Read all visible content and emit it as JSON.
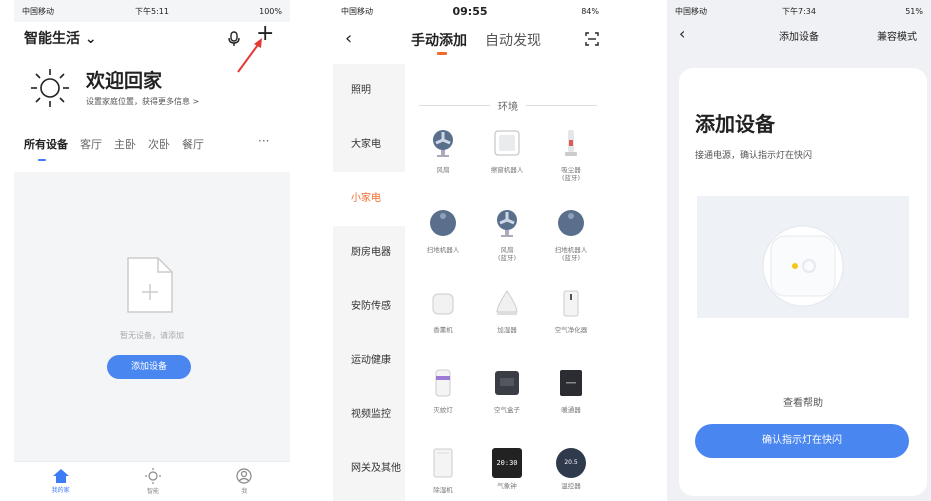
{
  "phone1": {
    "status": {
      "carrier": "中国移动",
      "time": "下午5:11",
      "battery": "100%"
    },
    "title": "智能生活",
    "title_chevron": "⌄",
    "add_icon": "+",
    "welcome": "欢迎回家",
    "welcome_sub": "设置家庭位置，获得更多信息 >",
    "tabs": [
      "所有设备",
      "客厅",
      "主卧",
      "次卧",
      "餐厅"
    ],
    "more_label": "···",
    "empty_text": "暂无设备，请添加",
    "add_button_label": "添加设备",
    "nav": [
      "我的家",
      "智能",
      "我"
    ],
    "accent": "#3d7cf5"
  },
  "phone2": {
    "status": {
      "carrier": "中国移动",
      "time": "09:55",
      "battery": "84%"
    },
    "back_icon": "‹",
    "tab_manual": "手动添加",
    "tab_auto": "自动发现",
    "categories": [
      "照明",
      "大家电",
      "小家电",
      "厨房电器",
      "安防传感",
      "运动健康",
      "视频监控",
      "网关及其他"
    ],
    "section_title": "环境",
    "devices": [
      {
        "label": "风扇",
        "icon": "fan-icon"
      },
      {
        "label": "擦窗机器人",
        "icon": "window-robot-icon"
      },
      {
        "label": "吸尘器\n(蓝牙)",
        "icon": "vacuum-icon"
      },
      {
        "label": "扫地机器人",
        "icon": "robot-vacuum-icon"
      },
      {
        "label": "风扇\n(蓝牙)",
        "icon": "fan-icon"
      },
      {
        "label": "扫地机器人\n(蓝牙)",
        "icon": "robot-vacuum-icon"
      },
      {
        "label": "香薰机",
        "icon": "aroma-icon"
      },
      {
        "label": "加湿器",
        "icon": "humidifier-icon"
      },
      {
        "label": "空气净化器",
        "icon": "purifier-icon"
      },
      {
        "label": "灭蚊灯",
        "icon": "mosquito-lamp-icon"
      },
      {
        "label": "空气盒子",
        "icon": "air-box-icon"
      },
      {
        "label": "暖通器",
        "icon": "heater-icon"
      },
      {
        "label": "除湿机",
        "icon": "dehumidifier-icon"
      },
      {
        "label": "气象钟",
        "icon": "weather-clock-icon"
      },
      {
        "label": "温控器",
        "icon": "thermostat-icon"
      }
    ],
    "clock_time": "20:30",
    "thermo_temp": "20.5",
    "accent": "#f06a2a"
  },
  "phone3": {
    "status": {
      "carrier": "中国移动",
      "time": "下午7:34",
      "battery": "51%"
    },
    "back_icon": "‹",
    "nav_title": "添加设备",
    "compat_mode": "兼容模式",
    "heading": "添加设备",
    "description": "接通电源，确认指示灯在快闪",
    "help_link": "查看帮助",
    "confirm_button": "确认指示灯在快闪"
  }
}
